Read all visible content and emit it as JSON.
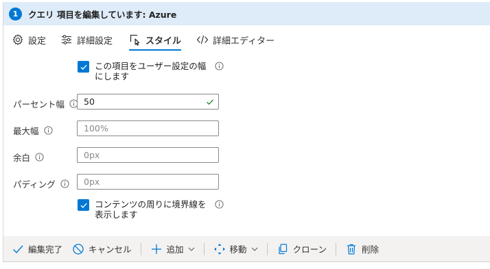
{
  "header": {
    "step": "1",
    "title": "クエリ 項目を編集しています: Azure"
  },
  "tabs": [
    {
      "label": "設定",
      "icon": "gear-icon"
    },
    {
      "label": "詳細設定",
      "icon": "sliders-icon"
    },
    {
      "label": "スタイル",
      "icon": "style-icon",
      "active": true
    },
    {
      "label": "詳細エディター",
      "icon": "code-icon"
    }
  ],
  "form": {
    "custom_width_check": {
      "label": "この項目をユーザー設定の幅にします",
      "checked": true
    },
    "percent_width": {
      "label": "パーセント幅",
      "value": "50"
    },
    "max_width": {
      "label": "最大幅",
      "placeholder": "100%"
    },
    "margin": {
      "label": "余白",
      "placeholder": "0px"
    },
    "padding": {
      "label": "パディング",
      "placeholder": "0px"
    },
    "border_check": {
      "label": "コンテンツの周りに境界線を表示します",
      "checked": true
    }
  },
  "commands": {
    "done": "編集完了",
    "cancel": "キャンセル",
    "add": "追加",
    "move": "移動",
    "clone": "クローン",
    "delete": "削除"
  },
  "colors": {
    "accent": "#0078d4",
    "header_bg": "#deecf9",
    "valid": "#107c10"
  }
}
